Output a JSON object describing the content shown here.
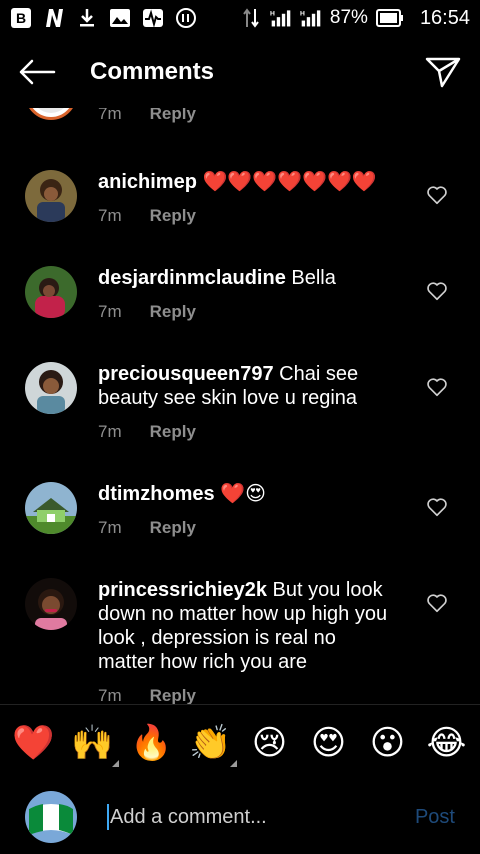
{
  "status_bar": {
    "battery": "87%",
    "time": "16:54",
    "icons": [
      "beta-b-icon",
      "n-icon",
      "download-icon",
      "image-icon",
      "pulse-icon",
      "radio-icon",
      "data-arrows-icon",
      "signal-h-icon",
      "signal-h-icon-2",
      "battery-icon"
    ]
  },
  "header": {
    "title": "Comments"
  },
  "comments": [
    {
      "username": "",
      "text": "",
      "time": "7m",
      "reply": "Reply"
    },
    {
      "username": "anichimep",
      "text": " ❤️❤️❤️❤️❤️❤️❤️",
      "time": "7m",
      "reply": "Reply"
    },
    {
      "username": "desjardinmclaudine",
      "text": " Bella",
      "time": "7m",
      "reply": "Reply"
    },
    {
      "username": "preciousqueen797",
      "text": " Chai see beauty see skin love u regina",
      "time": "7m",
      "reply": "Reply"
    },
    {
      "username": "dtimzhomes",
      "text": " ❤️😍",
      "time": "7m",
      "reply": "Reply"
    },
    {
      "username": "princessrichiey2k",
      "text": " But you look down no matter how up high you look , depression is real no matter how rich you are",
      "time": "7m",
      "reply": "Reply"
    }
  ],
  "emoji_bar": [
    "❤️",
    "🙌",
    "🔥",
    "👏",
    "😢",
    "😍",
    "😮",
    "😂"
  ],
  "composer": {
    "placeholder": "Add a comment...",
    "post_label": "Post"
  },
  "colors": {
    "background": "#000000",
    "meta_gray": "#8e8e8e",
    "post_blue": "#1e4a7a",
    "caret_blue": "#3fa9f5"
  }
}
